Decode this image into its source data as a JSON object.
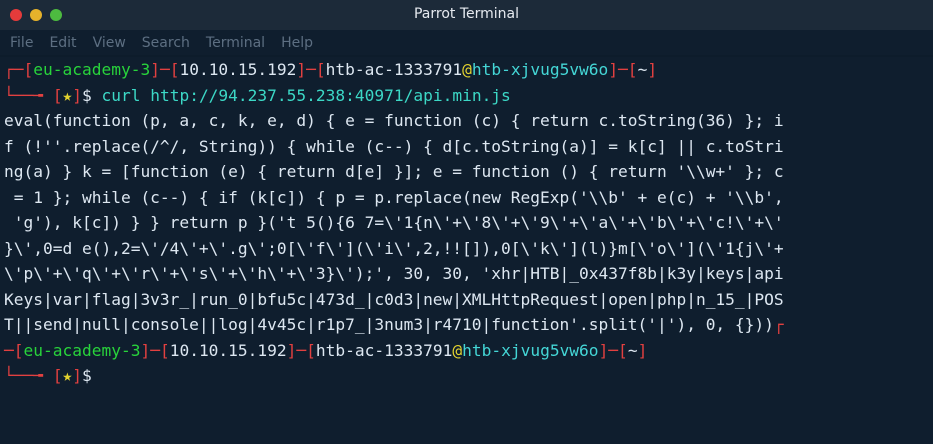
{
  "window": {
    "title": "Parrot Terminal",
    "menu": [
      "File",
      "Edit",
      "View",
      "Search",
      "Terminal",
      "Help"
    ]
  },
  "prompt": {
    "host": "eu-academy-3",
    "ip": "10.10.15.192",
    "user": "htb-ac-1333791",
    "at": "@",
    "machine": "htb-xjvug5vw6o",
    "cwd": "~",
    "star": "★",
    "dollar": "$"
  },
  "command": "curl http://94.237.55.238:40971/api.min.js",
  "output_lines": [
    "eval(function (p, a, c, k, e, d) { e = function (c) { return c.toString(36) }; i",
    "f (!''.replace(/^/, String)) { while (c--) { d[c.toString(a)] = k[c] || c.toStri",
    "ng(a) } k = [function (e) { return d[e] }]; e = function () { return '\\\\w+' }; c",
    " = 1 }; while (c--) { if (k[c]) { p = p.replace(new RegExp('\\\\b' + e(c) + '\\\\b',",
    " 'g'), k[c]) } } return p }('t 5(){6 7=\\'1{n\\'+\\'8\\'+\\'9\\'+\\'a\\'+\\'b\\'+\\'c!\\'+\\'",
    "}\\',0=d e(),2=\\'/4\\'+\\'.g\\';0[\\'f\\'](\\'i\\',2,!![]),0[\\'k\\'](l)}m[\\'o\\'](\\'1{j\\'+",
    "\\'p\\'+\\'q\\'+\\'r\\'+\\'s\\'+\\'h\\'+\\'3}\\');', 30, 30, 'xhr|HTB|_0x437f8b|k3y|keys|api",
    "Keys|var|flag|3v3r_|run_0|bfu5c|473d_|c0d3|new|XMLHttpRequest|open|php|n_15_|POS",
    "T||send|null|console||log|4v45c|r1p7_|3num3|r4710|function'.split('|'), 0, {}))"
  ]
}
